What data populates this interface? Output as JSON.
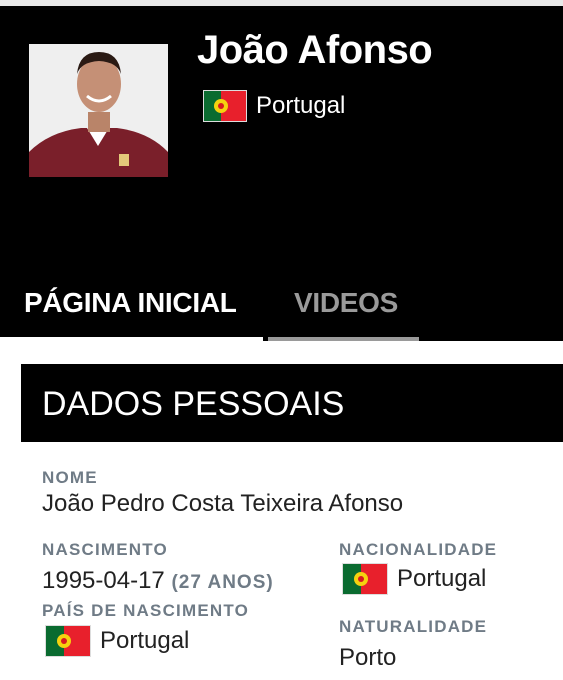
{
  "player": {
    "name": "João Afonso",
    "country": "Portugal"
  },
  "tabs": [
    {
      "label": "PÁGINA INICIAL",
      "active": true
    },
    {
      "label": "VIDEOS",
      "active": false
    }
  ],
  "personal": {
    "section_title": "DADOS PESSOAIS",
    "full_name_label": "NOME",
    "full_name": "João Pedro Costa Teixeira Afonso",
    "birth_label": "NASCIMENTO",
    "birth_date": "1995-04-17",
    "age": "(27 ANOS)",
    "nationality_label": "NACIONALIDADE",
    "nationality": "Portugal",
    "birth_country_label": "PAÍS DE NASCIMENTO",
    "birth_country": "Portugal",
    "birthplace_label": "NATURALIDADE",
    "birthplace": "Porto"
  },
  "icons": {
    "flag": "portugal-flag-icon"
  },
  "colors": {
    "header_bg": "#000000",
    "label_gray": "#6f7b86",
    "inactive_tab": "#9a9a9a"
  }
}
